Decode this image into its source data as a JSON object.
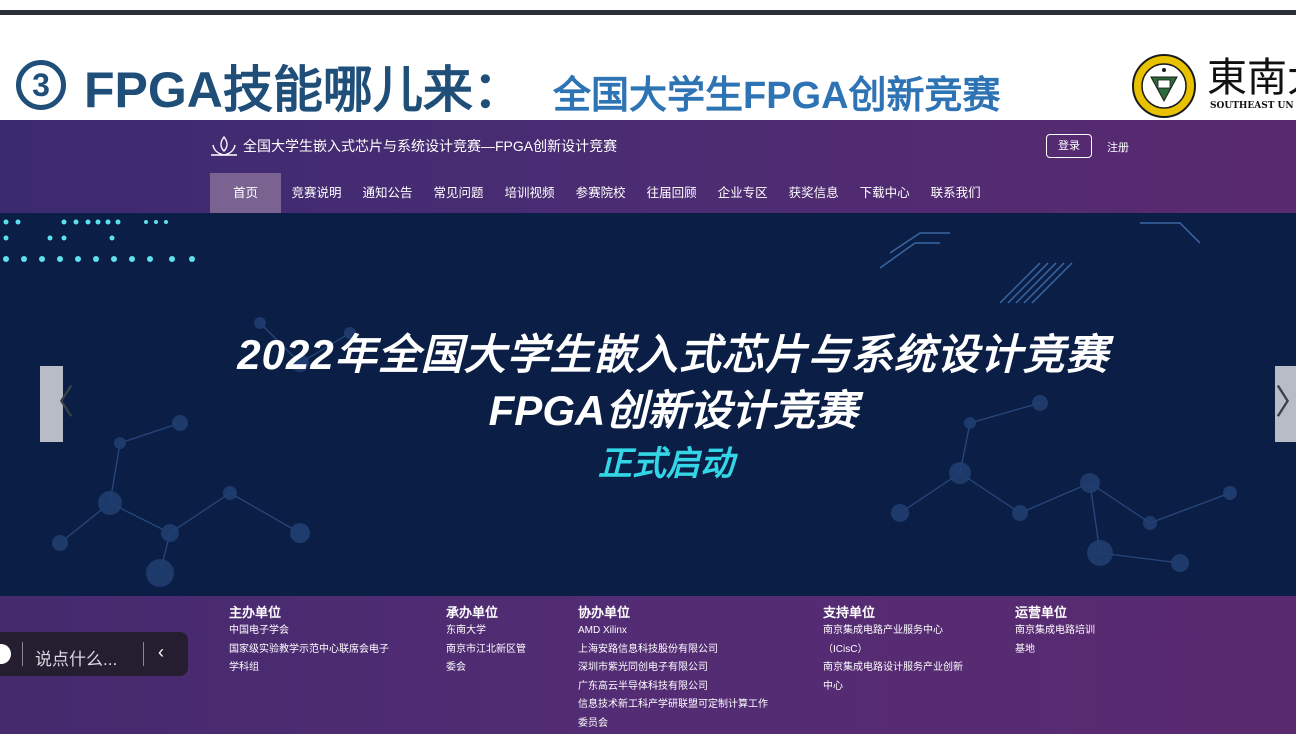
{
  "slide": {
    "number": "3",
    "title": "FPGA技能哪儿来：",
    "subtitle": "全国大学生FPGA创新竞赛",
    "university_cn": "東南大",
    "university_en": "SOUTHEAST UN",
    "seal_icon": "university-seal-icon"
  },
  "site": {
    "title": "全国大学生嵌入式芯片与系统设计竞赛—FPGA创新设计竞赛",
    "login_label": "登录",
    "register_label": "注册",
    "nav": [
      {
        "label": "首页",
        "active": true
      },
      {
        "label": "竞赛说明"
      },
      {
        "label": "通知公告"
      },
      {
        "label": "常见问题"
      },
      {
        "label": "培训视频"
      },
      {
        "label": "参赛院校"
      },
      {
        "label": "往届回顾"
      },
      {
        "label": "企业专区"
      },
      {
        "label": "获奖信息"
      },
      {
        "label": "下载中心"
      },
      {
        "label": "联系我们"
      }
    ]
  },
  "banner": {
    "line1": "2022年全国大学生嵌入式芯片与系统设计竞赛",
    "line2": "FPGA创新设计竞赛",
    "line3": "正式启动",
    "prev_arrow": "〈",
    "next_arrow": "〉",
    "accent_color": "#33d6e6"
  },
  "footer": {
    "columns": [
      {
        "title": "主办单位",
        "lines": [
          "中国电子学会",
          "国家级实验教学示范中心联席会电子",
          "学科组"
        ]
      },
      {
        "title": "承办单位",
        "lines": [
          "东南大学",
          "南京市江北新区管",
          "委会"
        ]
      },
      {
        "title": "协办单位",
        "lines": [
          "AMD Xilinx",
          "上海安路信息科技股份有限公司",
          "深圳市紫光同创电子有限公司",
          "广东高云半导体科技有限公司",
          "信息技术新工科产学研联盟可定制计算工作",
          "委员会"
        ]
      },
      {
        "title": "支持单位",
        "lines": [
          "南京集成电路产业服务中心",
          "（ICisC）",
          "南京集成电路设计服务产业创新",
          "中心"
        ]
      },
      {
        "title": "运营单位",
        "lines": [
          "南京集成电路培训",
          "基地"
        ]
      }
    ]
  },
  "comment": {
    "placeholder": "说点什么...",
    "collapse_icon": "chevron-left-icon"
  },
  "colors": {
    "header_purple": "#4a2c73",
    "banner_navy": "#0b1e45",
    "title_blue": "#1f4e79",
    "subtitle_blue": "#2e74b5"
  }
}
